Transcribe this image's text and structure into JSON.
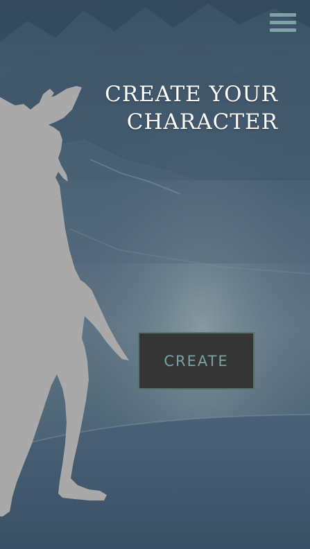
{
  "header": {
    "menu_icon": "hamburger-menu-icon",
    "title_line1": "CREATE YOUR",
    "title_line2": "CHARACTER"
  },
  "main": {
    "create_label": "CREATE"
  },
  "colors": {
    "menu_accent": "#7fa4a8",
    "button_bg": "#353535",
    "button_text": "#7aa2a3",
    "title_text": "#ffffff",
    "silhouette": "#a9a9a9"
  }
}
